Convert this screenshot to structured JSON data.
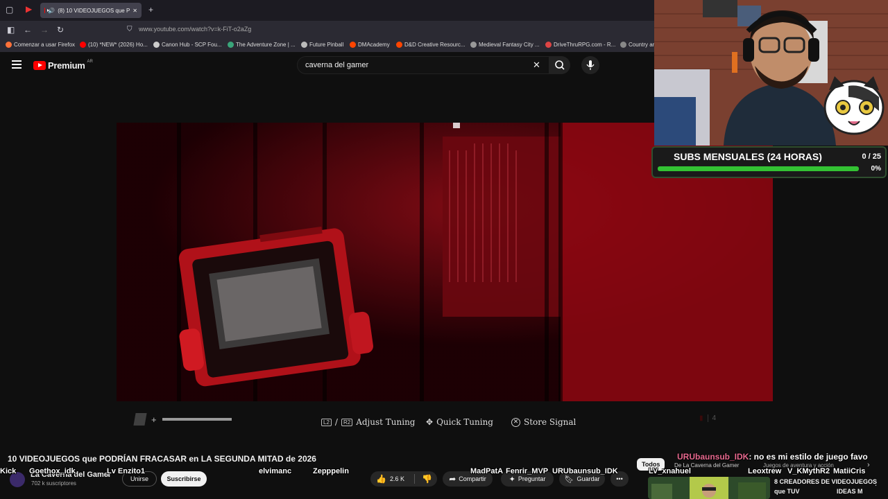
{
  "browser": {
    "tab_title": "(8) 10 VIDEOJUEGOS que P",
    "url": "www.youtube.com/watch?v=k-FiT-o2aZg",
    "bookmarks": [
      {
        "label": "Comenzar a usar Firefox",
        "color": "#ff7139"
      },
      {
        "label": "(10) *NEW* (2026) Ho...",
        "color": "#ff0000"
      },
      {
        "label": "Canon Hub - SCP Fou...",
        "color": "#cccccc"
      },
      {
        "label": "The Adventure Zone | ...",
        "color": "#3aa57a"
      },
      {
        "label": "Future Pinball",
        "color": "#bbbbbb"
      },
      {
        "label": "DMAcademy",
        "color": "#ff4500"
      },
      {
        "label": "D&D Creative Resourc...",
        "color": "#ff4500"
      },
      {
        "label": "Medieval Fantasy City ...",
        "color": "#999999"
      },
      {
        "label": "DriveThruRPG.com - R...",
        "color": "#d44"
      },
      {
        "label": "Country an",
        "color": "#888888"
      }
    ]
  },
  "youtube": {
    "logo_text": "Premium",
    "region": "AR",
    "search_value": "caverna del gamer"
  },
  "video": {
    "controls": {
      "adjust_keys": [
        "L2",
        "R2"
      ],
      "adjust_sep": "/",
      "adjust_label": "Adjust Tuning",
      "quick_label": "Quick Tuning",
      "store_label": "Store Signal",
      "counter": "4"
    }
  },
  "overlay": {
    "subs_label": "SUBS MENSUALES (24 HORAS)",
    "subs_count": "0 / 25",
    "subs_percent": "0%",
    "subs_progress": 0
  },
  "watch": {
    "title": "10 VIDEOJUEGOS que PODRÍAN FRACASAR en LA SEGUNDA MITAD de 2026",
    "channel": "La Caverna del Gamer",
    "subscribers": "702 k suscriptores",
    "join_label": "Unirse",
    "subscribe_label": "Suscribirse",
    "likes": "2.6 K",
    "share_label": "Compartir",
    "ask_label": "Preguntar",
    "save_label": "Guardar",
    "more_label": "•••"
  },
  "sidebar": {
    "chips": [
      "Todos",
      "De La Caverna del Gamer",
      "Juegos de aventura y acción"
    ],
    "suggested_title_1": "8 CREADORES DE VIDEOJUEGOS",
    "suggested_title_2": "que TUV",
    "suggested_title_3": "IDEAS M"
  },
  "chat": {
    "message_user": "URUbaunsub_IDK",
    "message_text": ": no es mi estilo de juego favo",
    "names": [
      "Kick",
      "Goethox_idk",
      "Lv Enzito1",
      "elvimanc",
      "Zepppelin",
      "MadPatA",
      "Fenrir_MVP",
      "URUbaunsub_IDK",
      "LV_xnahuel",
      "Leoxtrew",
      "V_KMythR2",
      "MatiiCris"
    ]
  }
}
